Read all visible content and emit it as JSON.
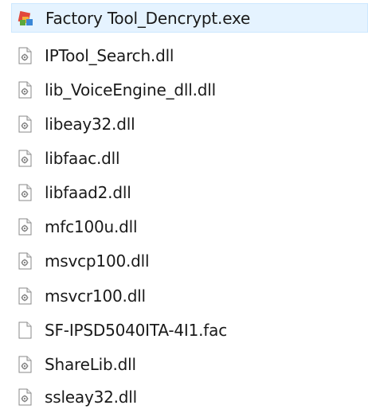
{
  "files": [
    {
      "name": "Factory Tool_Dencrypt.exe",
      "icon": "exe-app-icon",
      "selected": true
    },
    {
      "name": "IPTool_Search.dll",
      "icon": "dll-file-icon",
      "selected": false
    },
    {
      "name": "lib_VoiceEngine_dll.dll",
      "icon": "dll-file-icon",
      "selected": false
    },
    {
      "name": "libeay32.dll",
      "icon": "dll-file-icon",
      "selected": false
    },
    {
      "name": "libfaac.dll",
      "icon": "dll-file-icon",
      "selected": false
    },
    {
      "name": "libfaad2.dll",
      "icon": "dll-file-icon",
      "selected": false
    },
    {
      "name": "mfc100u.dll",
      "icon": "dll-file-icon",
      "selected": false
    },
    {
      "name": "msvcp100.dll",
      "icon": "dll-file-icon",
      "selected": false
    },
    {
      "name": "msvcr100.dll",
      "icon": "dll-file-icon",
      "selected": false
    },
    {
      "name": "SF-IPSD5040ITA-4I1.fac",
      "icon": "blank-file-icon",
      "selected": false
    },
    {
      "name": "ShareLib.dll",
      "icon": "dll-file-icon",
      "selected": false
    },
    {
      "name": "ssleay32.dll",
      "icon": "dll-file-icon",
      "selected": false
    }
  ],
  "colors": {
    "selection_background": "#e5f3ff",
    "selection_border": "#cce8ff",
    "text": "#1a1a1a"
  }
}
